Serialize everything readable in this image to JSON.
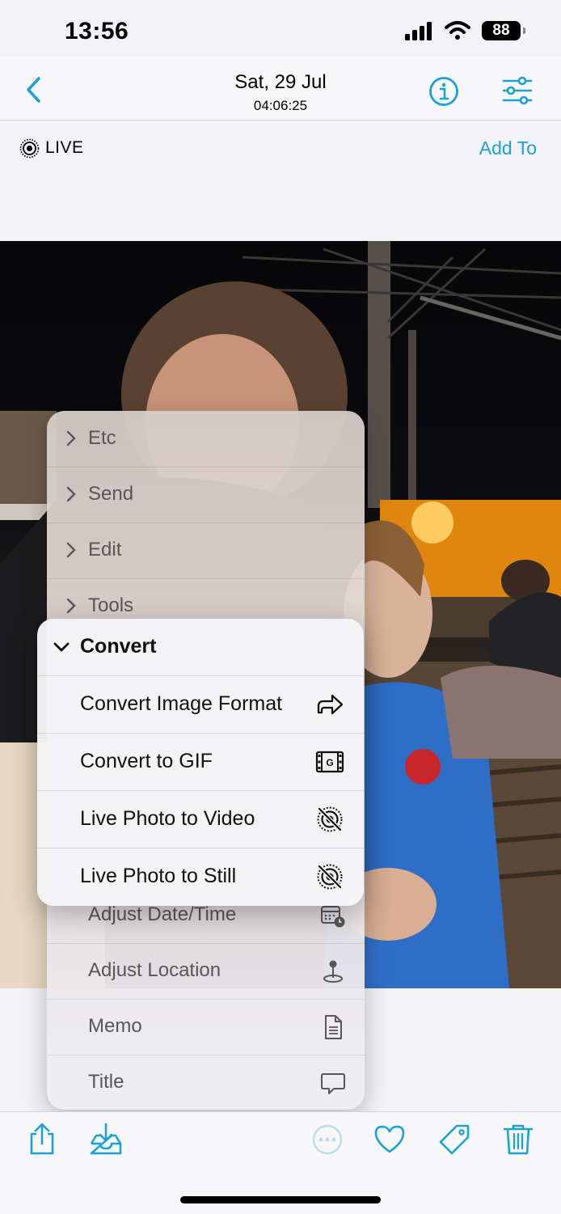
{
  "status": {
    "time": "13:56",
    "battery": "88"
  },
  "nav": {
    "date": "Sat, 29 Jul",
    "time": "04:06:25"
  },
  "live_bar": {
    "live_label": "LIVE",
    "add_to": "Add To"
  },
  "menu_back": {
    "top_items": [
      {
        "label": "Etc"
      },
      {
        "label": "Send"
      },
      {
        "label": "Edit"
      },
      {
        "label": "Tools"
      }
    ],
    "bottom_items": [
      {
        "label": "Adjust Date/Time",
        "icon": "calendar-clock-icon"
      },
      {
        "label": "Adjust Location",
        "icon": "location-pin-icon"
      },
      {
        "label": "Memo",
        "icon": "document-icon"
      },
      {
        "label": "Title",
        "icon": "speech-bubble-icon"
      }
    ]
  },
  "convert_menu": {
    "header": "Convert",
    "items": [
      {
        "label": "Convert Image Format",
        "icon": "share-arrow-icon"
      },
      {
        "label": "Convert to GIF",
        "icon": "gif-film-icon"
      },
      {
        "label": "Live Photo to Video",
        "icon": "live-off-icon"
      },
      {
        "label": "Live Photo to Still",
        "icon": "live-off-icon"
      }
    ]
  },
  "colors": {
    "accent": "#1ba1d6"
  }
}
